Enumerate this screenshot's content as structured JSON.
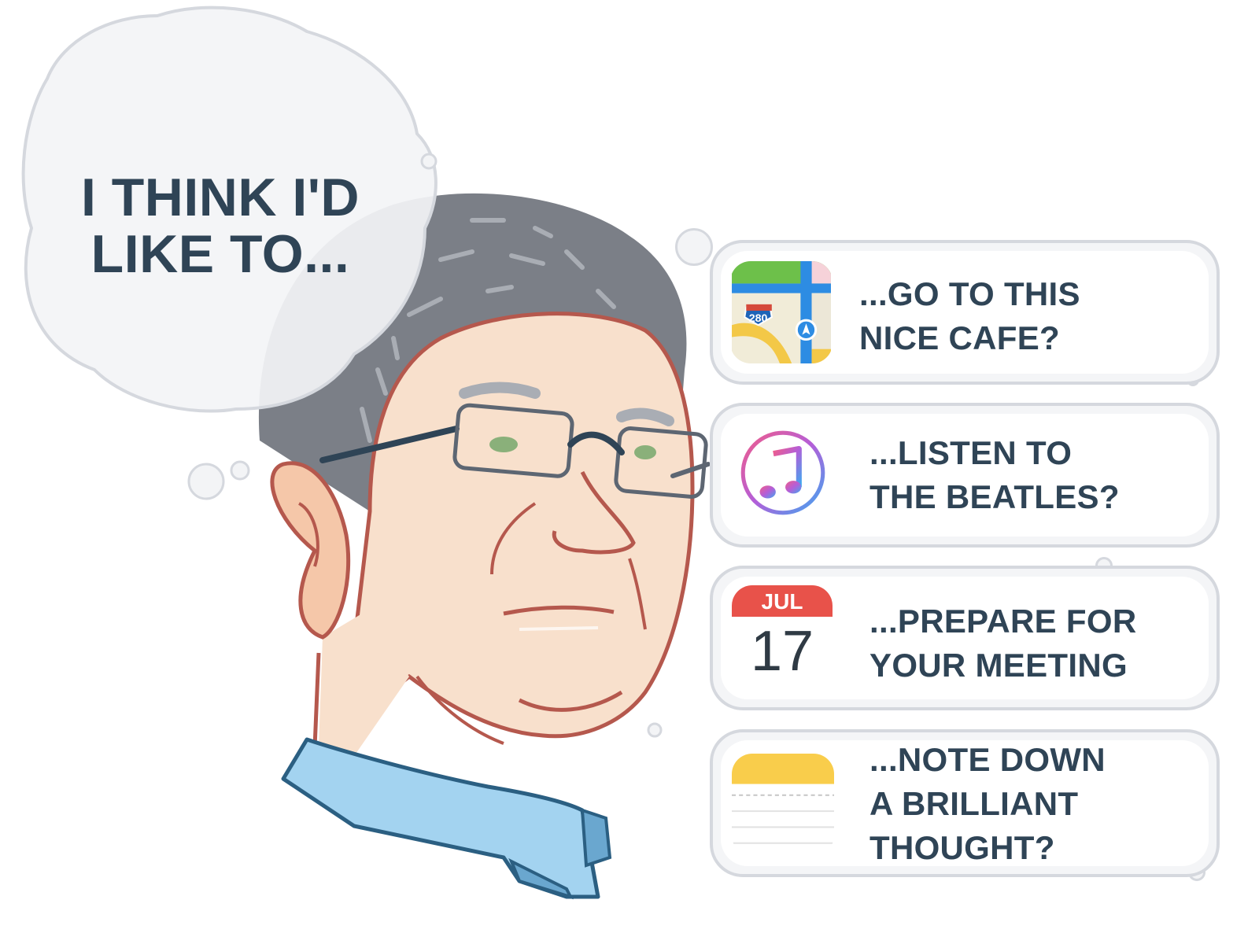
{
  "thought": {
    "line1": "I THINK I'D",
    "line2": "LIKE TO..."
  },
  "options": [
    {
      "icon": "maps-icon",
      "line1": "...GO TO THIS",
      "line2": "NICE CAFE?",
      "badge": "280"
    },
    {
      "icon": "music-icon",
      "line1": "...LISTEN TO",
      "line2": "THE BEATLES?"
    },
    {
      "icon": "calendar-icon",
      "line1": "...PREPARE FOR",
      "line2": "YOUR MEETING",
      "month": "JUL",
      "day": "17"
    },
    {
      "icon": "notes-icon",
      "line1": "...NOTE DOWN",
      "line2": "A BRILLIANT",
      "line3": "THOUGHT?"
    }
  ],
  "colors": {
    "text": "#2f4456",
    "bubble_border": "#d5d8de",
    "calendar_red": "#e8524a",
    "notes_yellow": "#f9cd4b",
    "shirt_blue": "#a3d3f0",
    "skin": "#f8e0cc",
    "hair": "#7b7f87"
  }
}
